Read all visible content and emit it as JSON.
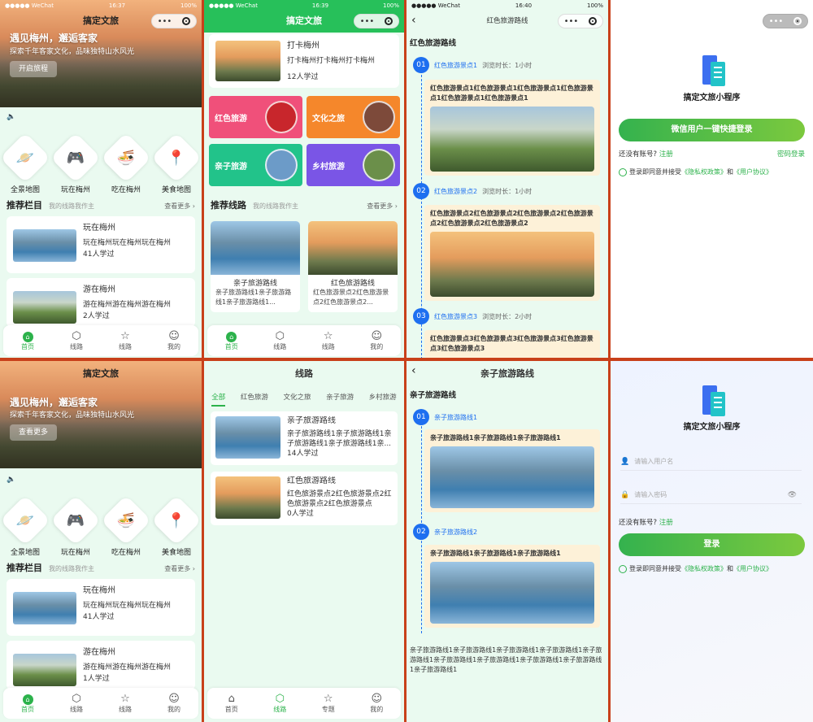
{
  "status": {
    "carrier": "●●●●● WeChat",
    "battery": "100%",
    "times": [
      "16:37",
      "16:39",
      "16:40"
    ]
  },
  "app": {
    "title": "搞定文旅",
    "mini_name": "搞定文旅小程序"
  },
  "home": {
    "hero_line1": "遇见梅州，邂逅客家",
    "hero_line2": "探索千年客家文化，品味独特山水风光",
    "hero_btn": "开启旅程",
    "hero_btn_alt": "查看更多",
    "features": [
      {
        "label": "全景地图",
        "icon": "planet-icon"
      },
      {
        "label": "玩在梅州",
        "icon": "gamepad-icon"
      },
      {
        "label": "吃在梅州",
        "icon": "bowl-icon"
      },
      {
        "label": "美食地图",
        "icon": "map-pin-icon"
      }
    ],
    "section_title": "推荐栏目",
    "section_sub": "我的线路我作主",
    "section_more": "查看更多",
    "cards": [
      {
        "title": "玩在梅州",
        "desc": "玩在梅州玩在梅州玩在梅州",
        "meta": "41人学过"
      },
      {
        "title": "游在梅州",
        "desc": "游在梅州游在梅州游在梅州",
        "meta": "2人学过"
      }
    ],
    "cards_alt_meta": "1人学过"
  },
  "tabbar": {
    "home": "首页",
    "route": "线路",
    "route2": "线路",
    "topic": "专题",
    "mine": "我的"
  },
  "routes_page": {
    "top_card": {
      "title": "打卡梅州",
      "desc": "打卡梅州打卡梅州打卡梅州",
      "meta": "12人学过"
    },
    "tiles": [
      {
        "label": "红色旅游",
        "color": "#f0507a"
      },
      {
        "label": "文化之旅",
        "color": "#f5872b"
      },
      {
        "label": "亲子旅游",
        "color": "#22c38a"
      },
      {
        "label": "乡村旅游",
        "color": "#7a55e6"
      }
    ],
    "section_title": "推荐线路",
    "section_sub": "我的线路我作主",
    "section_more": "查看更多",
    "grid": [
      {
        "title": "亲子旅游路线",
        "desc": "亲子旅游路线1亲子旅游路线1亲子旅游路线1..."
      },
      {
        "title": "红色旅游路线",
        "desc": "红色旅游景点2红色旅游景点2红色旅游景点2..."
      }
    ]
  },
  "red_route": {
    "nav_title": "红色旅游路线",
    "page_title": "红色旅游路线",
    "steps": [
      {
        "num": "01",
        "name": "红色旅游景点1",
        "duration": "浏览时长：1小时",
        "text": "红色旅游景点1红色旅游景点1红色旅游景点1红色旅游景点1红色旅游景点1红色旅游景点1"
      },
      {
        "num": "02",
        "name": "红色旅游景点2",
        "duration": "浏览时长：1小时",
        "text": "红色旅游景点2红色旅游景点2红色旅游景点2红色旅游景点2红色旅游景点2红色旅游景点2"
      },
      {
        "num": "03",
        "name": "红色旅游景点3",
        "duration": "浏览时长：2小时",
        "text": "红色旅游景点3红色旅游景点3红色旅游景点3红色旅游景点3红色旅游景点3"
      }
    ]
  },
  "login_wechat": {
    "btn": "微信用户一键快捷登录",
    "no_account": "还没有账号?",
    "register": "注册",
    "pwd_login": "密码登录",
    "agree_prefix": "登录即同意并接受",
    "privacy": "《隐私权政策》",
    "and": "和",
    "user_agreement": "《用户协议》"
  },
  "route_list": {
    "nav_title": "线路",
    "filters": [
      "全部",
      "红色旅游",
      "文化之旅",
      "亲子旅游",
      "乡村旅游"
    ],
    "items": [
      {
        "title": "亲子旅游路线",
        "desc": "亲子旅游路线1亲子旅游路线1亲子旅游路线1亲子旅游路线1亲...",
        "meta": "14人学过"
      },
      {
        "title": "红色旅游路线",
        "desc": "红色旅游景点2红色旅游景点2红色旅游景点2红色旅游景点",
        "meta": "0人学过"
      }
    ]
  },
  "kids_route": {
    "nav_title": "亲子旅游路线",
    "page_title": "亲子旅游路线",
    "steps": [
      {
        "num": "01",
        "name": "亲子旅游路线1",
        "text": "亲子旅游路线1亲子旅游路线1亲子旅游路线1"
      },
      {
        "num": "02",
        "name": "亲子旅游路线2",
        "text": "亲子旅游路线1亲子旅游路线1亲子旅游路线1"
      }
    ],
    "footer": "亲子旅游路线1亲子旅游路线1亲子旅游路线1亲子旅游路线1亲子旅游路线1亲子旅游路线1亲子旅游路线1亲子旅游路线1亲子旅游路线1亲子旅游路线1"
  },
  "login_pwd": {
    "user_placeholder": "请输入用户名",
    "pwd_placeholder": "请输入密码",
    "no_account": "还没有账号?",
    "register": "注册",
    "btn": "登录",
    "agree_prefix": "登录即同意并接受",
    "privacy": "《隐私权政策》",
    "and": "和",
    "user_agreement": "《用户协议》"
  }
}
